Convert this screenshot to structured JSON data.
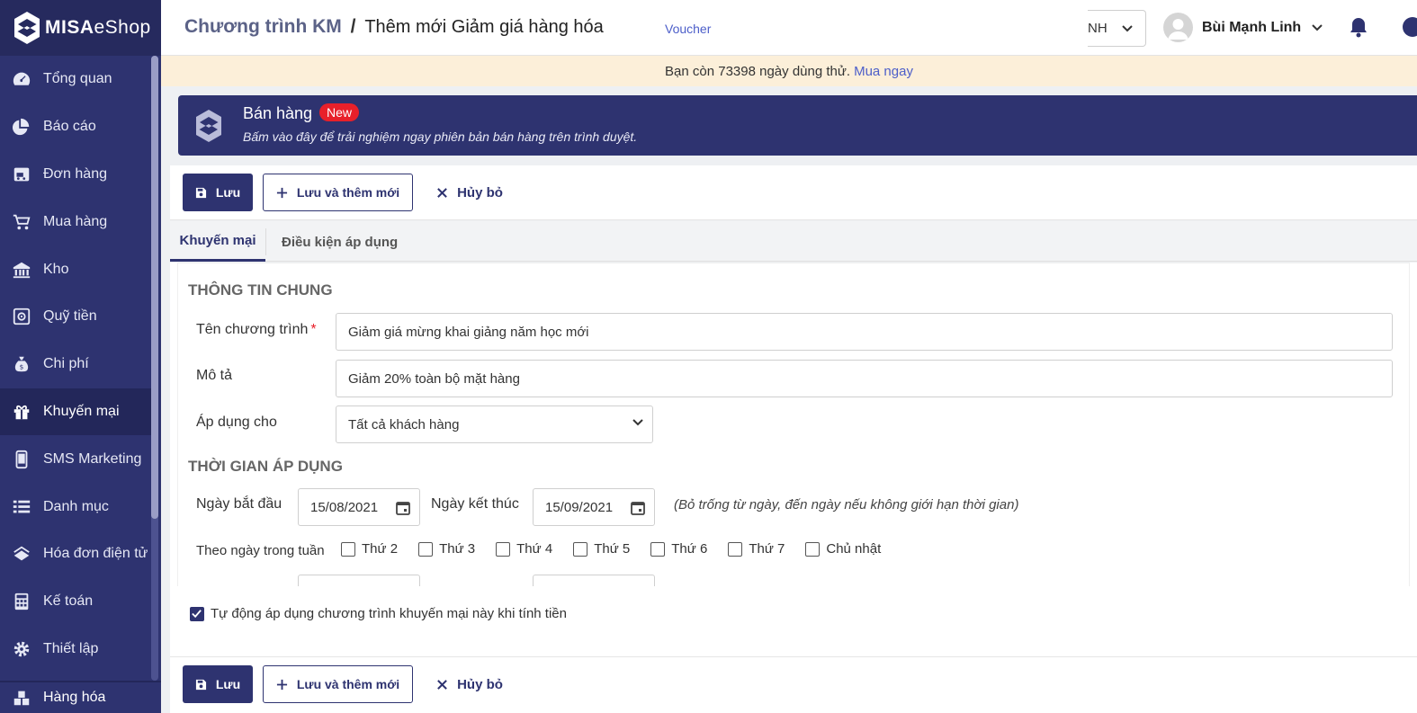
{
  "app": {
    "logo_bold": "MISA",
    "logo_thin": "eShop"
  },
  "sidebar": {
    "items": [
      {
        "label": "Tổng quan",
        "icon": "dashboard-icon"
      },
      {
        "label": "Báo cáo",
        "icon": "pie-chart-icon"
      },
      {
        "label": "Đơn hàng",
        "icon": "delivery-truck-icon"
      },
      {
        "label": "Mua hàng",
        "icon": "shopping-cart-icon"
      },
      {
        "label": "Kho",
        "icon": "warehouse-icon"
      },
      {
        "label": "Quỹ tiền",
        "icon": "safe-icon"
      },
      {
        "label": "Chi phí",
        "icon": "money-bag-icon"
      },
      {
        "label": "Khuyến mại",
        "icon": "gift-icon",
        "active": true
      },
      {
        "label": "SMS Marketing",
        "icon": "phone-icon"
      },
      {
        "label": "Danh mục",
        "icon": "list-icon"
      },
      {
        "label": "Hóa đơn điện tử",
        "icon": "e-invoice-icon"
      },
      {
        "label": "Kế toán",
        "icon": "calculator-icon"
      },
      {
        "label": "Thiết lập",
        "icon": "gear-icon"
      }
    ],
    "bottom_item": {
      "label": "Hàng hóa",
      "icon": "boxes-icon"
    }
  },
  "header": {
    "breadcrumb_root": "Chương trình KM",
    "breadcrumb_sep": "/",
    "breadcrumb_current": "Thêm mới Giảm giá hàng hóa",
    "voucher_link": "Voucher",
    "branch_value": "NH",
    "user_name": "Bùi Mạnh Linh"
  },
  "trial": {
    "text": "Bạn còn 73398 ngày dùng thử.",
    "buy_link": "Mua ngay"
  },
  "banner": {
    "title": "Bán hàng",
    "badge": "New",
    "subtitle": "Bấm vào đây để trải nghiệm ngay phiên bản bán hàng trên trình duyệt."
  },
  "toolbar": {
    "save": "Lưu",
    "save_new": "Lưu và thêm mới",
    "cancel": "Hủy bỏ"
  },
  "tabs": {
    "promo": "Khuyến mại",
    "conditions": "Điều kiện áp dụng"
  },
  "form": {
    "general_title": "THÔNG TIN CHUNG",
    "name_label": "Tên chương trình",
    "name_required": "*",
    "name_value": "Giảm giá mừng khai giảng năm học mới",
    "desc_label": "Mô tả",
    "desc_value": "Giảm 20% toàn bộ mặt hàng",
    "apply_label": "Áp dụng cho",
    "apply_value": "Tất cả khách hàng",
    "time_title": "THỜI GIAN ÁP DỤNG",
    "start_label": "Ngày bắt đầu",
    "start_value": "15/08/2021",
    "end_label": "Ngày kết thúc",
    "end_value": "15/09/2021",
    "hint": "(Bỏ trống từ ngày, đến ngày nếu không giới hạn thời gian)",
    "weekday_label": "Theo ngày trong tuần",
    "weekdays": [
      "Thứ 2",
      "Thứ 3",
      "Thứ 4",
      "Thứ 5",
      "Thứ 6",
      "Thứ 7",
      "Chủ nhật"
    ],
    "auto_apply": "Tự động áp dụng chương trình khuyến mại này khi tính tiền",
    "auto_apply_checked": true
  }
}
